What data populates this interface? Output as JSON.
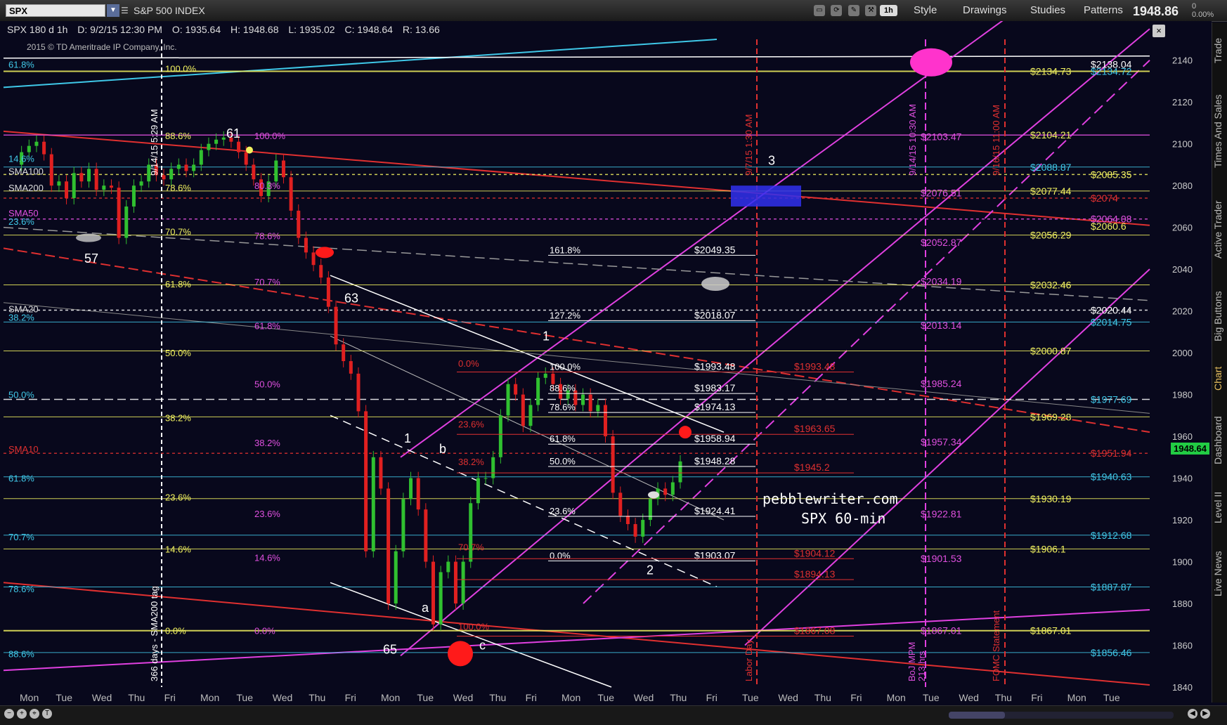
{
  "toolbar": {
    "symbol": "SPX",
    "symbol_name": "S&P 500 INDEX",
    "timeframe_button": "1h",
    "style_label": "Style",
    "drawings_label": "Drawings",
    "studies_label": "Studies",
    "patterns_label": "Patterns",
    "last_price": "1948.86",
    "change": "0",
    "change_pct": "0.00%"
  },
  "infobar": {
    "period": "SPX 180 d 1h",
    "date": "D: 9/2/15 12:30 PM",
    "open": "O: 1935.64",
    "high": "H: 1948.68",
    "low": "L: 1935.02",
    "close": "C: 1948.64",
    "range": "R: 13.66"
  },
  "copyright": "2015 © TD Ameritrade IP Company, Inc.",
  "watermark": "pebblewriter.com",
  "watermark2": "SPX 60-min",
  "price_tag": "1948.64",
  "right_rail": [
    "Trade",
    "Times And Sales",
    "Active Trader",
    "Big Buttons",
    "Chart",
    "Dashboard",
    "Level II",
    "Live News"
  ],
  "active_rail": "Chart",
  "chart_data": {
    "type": "line",
    "title": "",
    "xlabel": "",
    "ylabel": "",
    "ylim": [
      1840,
      2150
    ],
    "y_ticks": [
      1840,
      1860,
      1880,
      1900,
      1920,
      1940,
      1960,
      1980,
      2000,
      2020,
      2040,
      2060,
      2080,
      2100,
      2120,
      2140
    ],
    "x_ticks": [
      "Mon",
      "Tue",
      "Wed",
      "Thu",
      "Fri",
      "Mon",
      "Tue",
      "Wed",
      "Thu",
      "Fri",
      "Mon",
      "Tue",
      "Wed",
      "Thu",
      "Fri",
      "Mon",
      "Tue",
      "Wed",
      "Thu",
      "Fri",
      "Tue",
      "Wed",
      "Thu",
      "Fri",
      "Mon",
      "Tue",
      "Wed",
      "Thu",
      "Fri",
      "Mon",
      "Tue"
    ],
    "series": [
      {
        "values": [
          2090,
          2096,
          2099,
          2101,
          2095,
          2080,
          2082,
          2074,
          2086,
          2082,
          2088,
          2078,
          2080,
          2079,
          2055,
          2070,
          2080,
          2082,
          2090,
          2085,
          2083,
          2088,
          2090,
          2087,
          2090,
          2097,
          2100,
          2102,
          2103,
          2101,
          2096,
          2090,
          2083,
          2075,
          2082,
          2092,
          2084,
          2068,
          2055,
          2048,
          2042,
          2036,
          2022,
          2004,
          1996,
          1990,
          1972,
          1905,
          1950,
          1935,
          1880,
          1905,
          1930,
          1940,
          1925,
          1900,
          1870,
          1895,
          1900,
          1880,
          1900,
          1928,
          1940,
          1940,
          1950,
          1970,
          1985,
          1980,
          1965,
          1975,
          1988,
          1990,
          1985,
          1978,
          1982,
          1975,
          1980,
          1972,
          1975,
          1960,
          1933,
          1922,
          1918,
          1912,
          1920,
          1930,
          1935,
          1932,
          1938,
          1948
        ]
      }
    ],
    "right_axis_labels": [
      {
        "text": "$2138.04",
        "value": 2138.04
      },
      {
        "text": "$2134.73",
        "value": 2134.73
      },
      {
        "text": "$2134.72",
        "value": 2134.72
      },
      {
        "text": "$2104.21",
        "value": 2104.21
      },
      {
        "text": "$2088.87",
        "value": 2088.87
      },
      {
        "text": "$2085.35",
        "value": 2085.35
      },
      {
        "text": "$2077.44",
        "value": 2077.44
      },
      {
        "text": "$2074",
        "value": 2074
      },
      {
        "text": "$2064.08",
        "value": 2064.08
      },
      {
        "text": "$2060.6",
        "value": 2060.6
      },
      {
        "text": "$2056.29",
        "value": 2056.29
      },
      {
        "text": "$2032.46",
        "value": 2032.46
      },
      {
        "text": "$2020.44",
        "value": 2020.44
      },
      {
        "text": "$2014.75",
        "value": 2014.75
      },
      {
        "text": "$2000.87",
        "value": 2000.87
      },
      {
        "text": "$1977.69",
        "value": 1977.69
      },
      {
        "text": "$1969.28",
        "value": 1969.28
      },
      {
        "text": "$1951.94",
        "value": 1951.94
      },
      {
        "text": "$1940.63",
        "value": 1940.63
      },
      {
        "text": "$1930.19",
        "value": 1930.19
      },
      {
        "text": "$1912.68",
        "value": 1912.68
      },
      {
        "text": "$1906.1",
        "value": 1906.1
      },
      {
        "text": "$1887.87",
        "value": 1887.87
      },
      {
        "text": "$1867.01",
        "value": 1867.01
      },
      {
        "text": "$1856.46",
        "value": 1856.46
      }
    ],
    "mid_labels_white": [
      {
        "text": "$2049.35",
        "value": 2049.35
      },
      {
        "text": "$2018.07",
        "value": 2018.07
      },
      {
        "text": "$1993.48",
        "value": 1993.48
      },
      {
        "text": "$1983.17",
        "value": 1983.17
      },
      {
        "text": "$1974.13",
        "value": 1974.13
      },
      {
        "text": "$1958.94",
        "value": 1958.94
      },
      {
        "text": "$1948.28",
        "value": 1948.28
      },
      {
        "text": "$1924.41",
        "value": 1924.41
      },
      {
        "text": "$1903.07",
        "value": 1903.07
      }
    ],
    "mid_fib_white": [
      "161.8%",
      "127.2%",
      "100.0%",
      "88.6%",
      "78.6%",
      "61.8%",
      "50.0%",
      "23.6%",
      "0.0%"
    ],
    "red_labels": [
      {
        "text": "$1993.48",
        "value": 1993.48
      },
      {
        "text": "$1963.65",
        "value": 1963.65
      },
      {
        "text": "$1945.2",
        "value": 1945.2
      },
      {
        "text": "$1904.12",
        "value": 1904.12
      },
      {
        "text": "$1894.13",
        "value": 1894.13
      },
      {
        "text": "$1867.08",
        "value": 1867.08
      }
    ],
    "red_fibs": [
      {
        "text": "0.0%",
        "value": 1995
      },
      {
        "text": "23.6%",
        "value": 1966
      },
      {
        "text": "38.2%",
        "value": 1948
      },
      {
        "text": "70.7%",
        "value": 1907
      },
      {
        "text": "100.0%",
        "value": 1869
      }
    ],
    "magenta_labels": [
      {
        "text": "$2103.47",
        "value": 2103.47
      },
      {
        "text": "$2076.51",
        "value": 2076.51
      },
      {
        "text": "$2052.87",
        "value": 2052.87
      },
      {
        "text": "$2034.19",
        "value": 2034.19
      },
      {
        "text": "$2013.14",
        "value": 2013.14
      },
      {
        "text": "$1985.24",
        "value": 1985.24
      },
      {
        "text": "$1957.34",
        "value": 1957.34
      },
      {
        "text": "$1922.81",
        "value": 1922.81
      },
      {
        "text": "$1901.53",
        "value": 1901.53
      },
      {
        "text": "$1867.01",
        "value": 1867.01
      }
    ],
    "left_fib_a": [
      {
        "text": "61.8%",
        "value": 2138
      },
      {
        "text": "14.6%",
        "value": 2093
      },
      {
        "text": "23.6%",
        "value": 2063
      },
      {
        "text": "38.2%",
        "value": 2017
      },
      {
        "text": "50.0%",
        "value": 1980
      },
      {
        "text": "61.8%",
        "value": 1940
      },
      {
        "text": "70.7%",
        "value": 1912
      },
      {
        "text": "78.6%",
        "value": 1887
      },
      {
        "text": "88.6%",
        "value": 1856
      }
    ],
    "sma_labels": [
      {
        "text": "SMA100",
        "value": 2087
      },
      {
        "text": "SMA200",
        "value": 2079
      },
      {
        "text": "SMA50",
        "value": 2067
      },
      {
        "text": "SMA20",
        "value": 2021
      },
      {
        "text": "SMA10",
        "value": 1954
      }
    ],
    "left_fib_b": [
      {
        "text": "100.0%",
        "value": 2136
      },
      {
        "text": "88.6%",
        "value": 2104
      },
      {
        "text": "78.6%",
        "value": 2079
      },
      {
        "text": "70.7%",
        "value": 2058
      },
      {
        "text": "61.8%",
        "value": 2033
      },
      {
        "text": "50.0%",
        "value": 2000
      },
      {
        "text": "38.2%",
        "value": 1969
      },
      {
        "text": "23.6%",
        "value": 1931
      },
      {
        "text": "14.6%",
        "value": 1906
      },
      {
        "text": "0.0%",
        "value": 1867
      }
    ],
    "left_fib_c": [
      {
        "text": "100.0%",
        "value": 2104
      },
      {
        "text": "80.3%",
        "value": 2080
      },
      {
        "text": "78.6%",
        "value": 2056
      },
      {
        "text": "70.7%",
        "value": 2034
      },
      {
        "text": "61.8%",
        "value": 2013
      },
      {
        "text": "50.0%",
        "value": 1985
      },
      {
        "text": "38.2%",
        "value": 1957
      },
      {
        "text": "23.6%",
        "value": 1923
      },
      {
        "text": "14.6%",
        "value": 1902
      },
      {
        "text": "0.0%",
        "value": 1867
      }
    ],
    "wave_labels": [
      "57",
      "61",
      "63",
      "65",
      "1",
      "b",
      "a",
      "c",
      "1",
      "2",
      "3"
    ],
    "vertical_markers": [
      "9/7/15 1:30 AM",
      "9/14/15 10:30 AM",
      "9/16/15 11:00 AM",
      "9/14/15 5:29 AM",
      "Labor Day",
      "BoJ MPM",
      "213 hrs",
      "FOMC Statement",
      "366 days - SMA200 tag"
    ]
  }
}
